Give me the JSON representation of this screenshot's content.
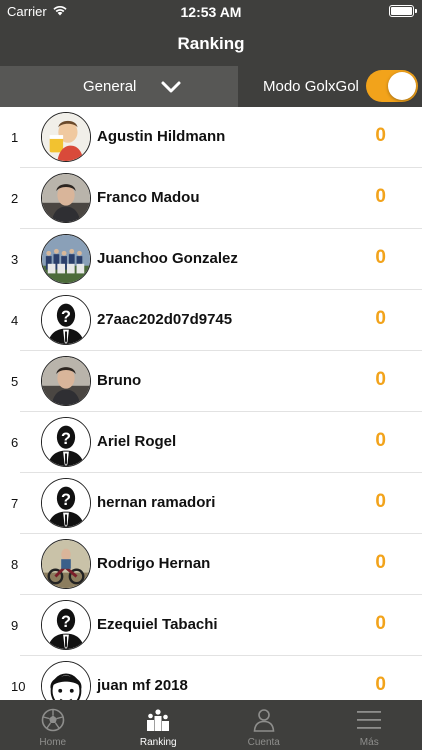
{
  "status": {
    "carrier": "Carrier",
    "time": "12:53 AM"
  },
  "nav": {
    "title": "Ranking"
  },
  "filter": {
    "selected": "General",
    "mode_label": "Modo GolxGol",
    "mode_on": true
  },
  "colors": {
    "accent": "#f2a31b",
    "bar": "#3f3f3d",
    "segment": "#575755"
  },
  "ranking": [
    {
      "rank": "1",
      "name": "Agustin Hildmann",
      "points": "0",
      "avatar": "photo-cartoon"
    },
    {
      "rank": "2",
      "name": "Franco Madou",
      "points": "0",
      "avatar": "photo"
    },
    {
      "rank": "3",
      "name": "Juanchoo Gonzalez",
      "points": "0",
      "avatar": "photo-team"
    },
    {
      "rank": "4",
      "name": "27aac202d07d9745",
      "points": "0",
      "avatar": "unknown-user"
    },
    {
      "rank": "5",
      "name": "Bruno",
      "points": "0",
      "avatar": "photo"
    },
    {
      "rank": "6",
      "name": "Ariel Rogel",
      "points": "0",
      "avatar": "unknown-user"
    },
    {
      "rank": "7",
      "name": "hernan ramadori",
      "points": "0",
      "avatar": "unknown-user"
    },
    {
      "rank": "8",
      "name": "Rodrigo Hernan",
      "points": "0",
      "avatar": "photo-bike"
    },
    {
      "rank": "9",
      "name": "Ezequiel Tabachi",
      "points": "0",
      "avatar": "unknown-user"
    },
    {
      "rank": "10",
      "name": "juan mf 2018",
      "points": "0",
      "avatar": "drawing-face"
    }
  ],
  "tabs": [
    {
      "label": "Home",
      "icon": "soccer-ball-icon",
      "active": false
    },
    {
      "label": "Ranking",
      "icon": "podium-icon",
      "active": true
    },
    {
      "label": "Cuenta",
      "icon": "user-icon",
      "active": false
    },
    {
      "label": "Más",
      "icon": "menu-icon",
      "active": false
    }
  ]
}
